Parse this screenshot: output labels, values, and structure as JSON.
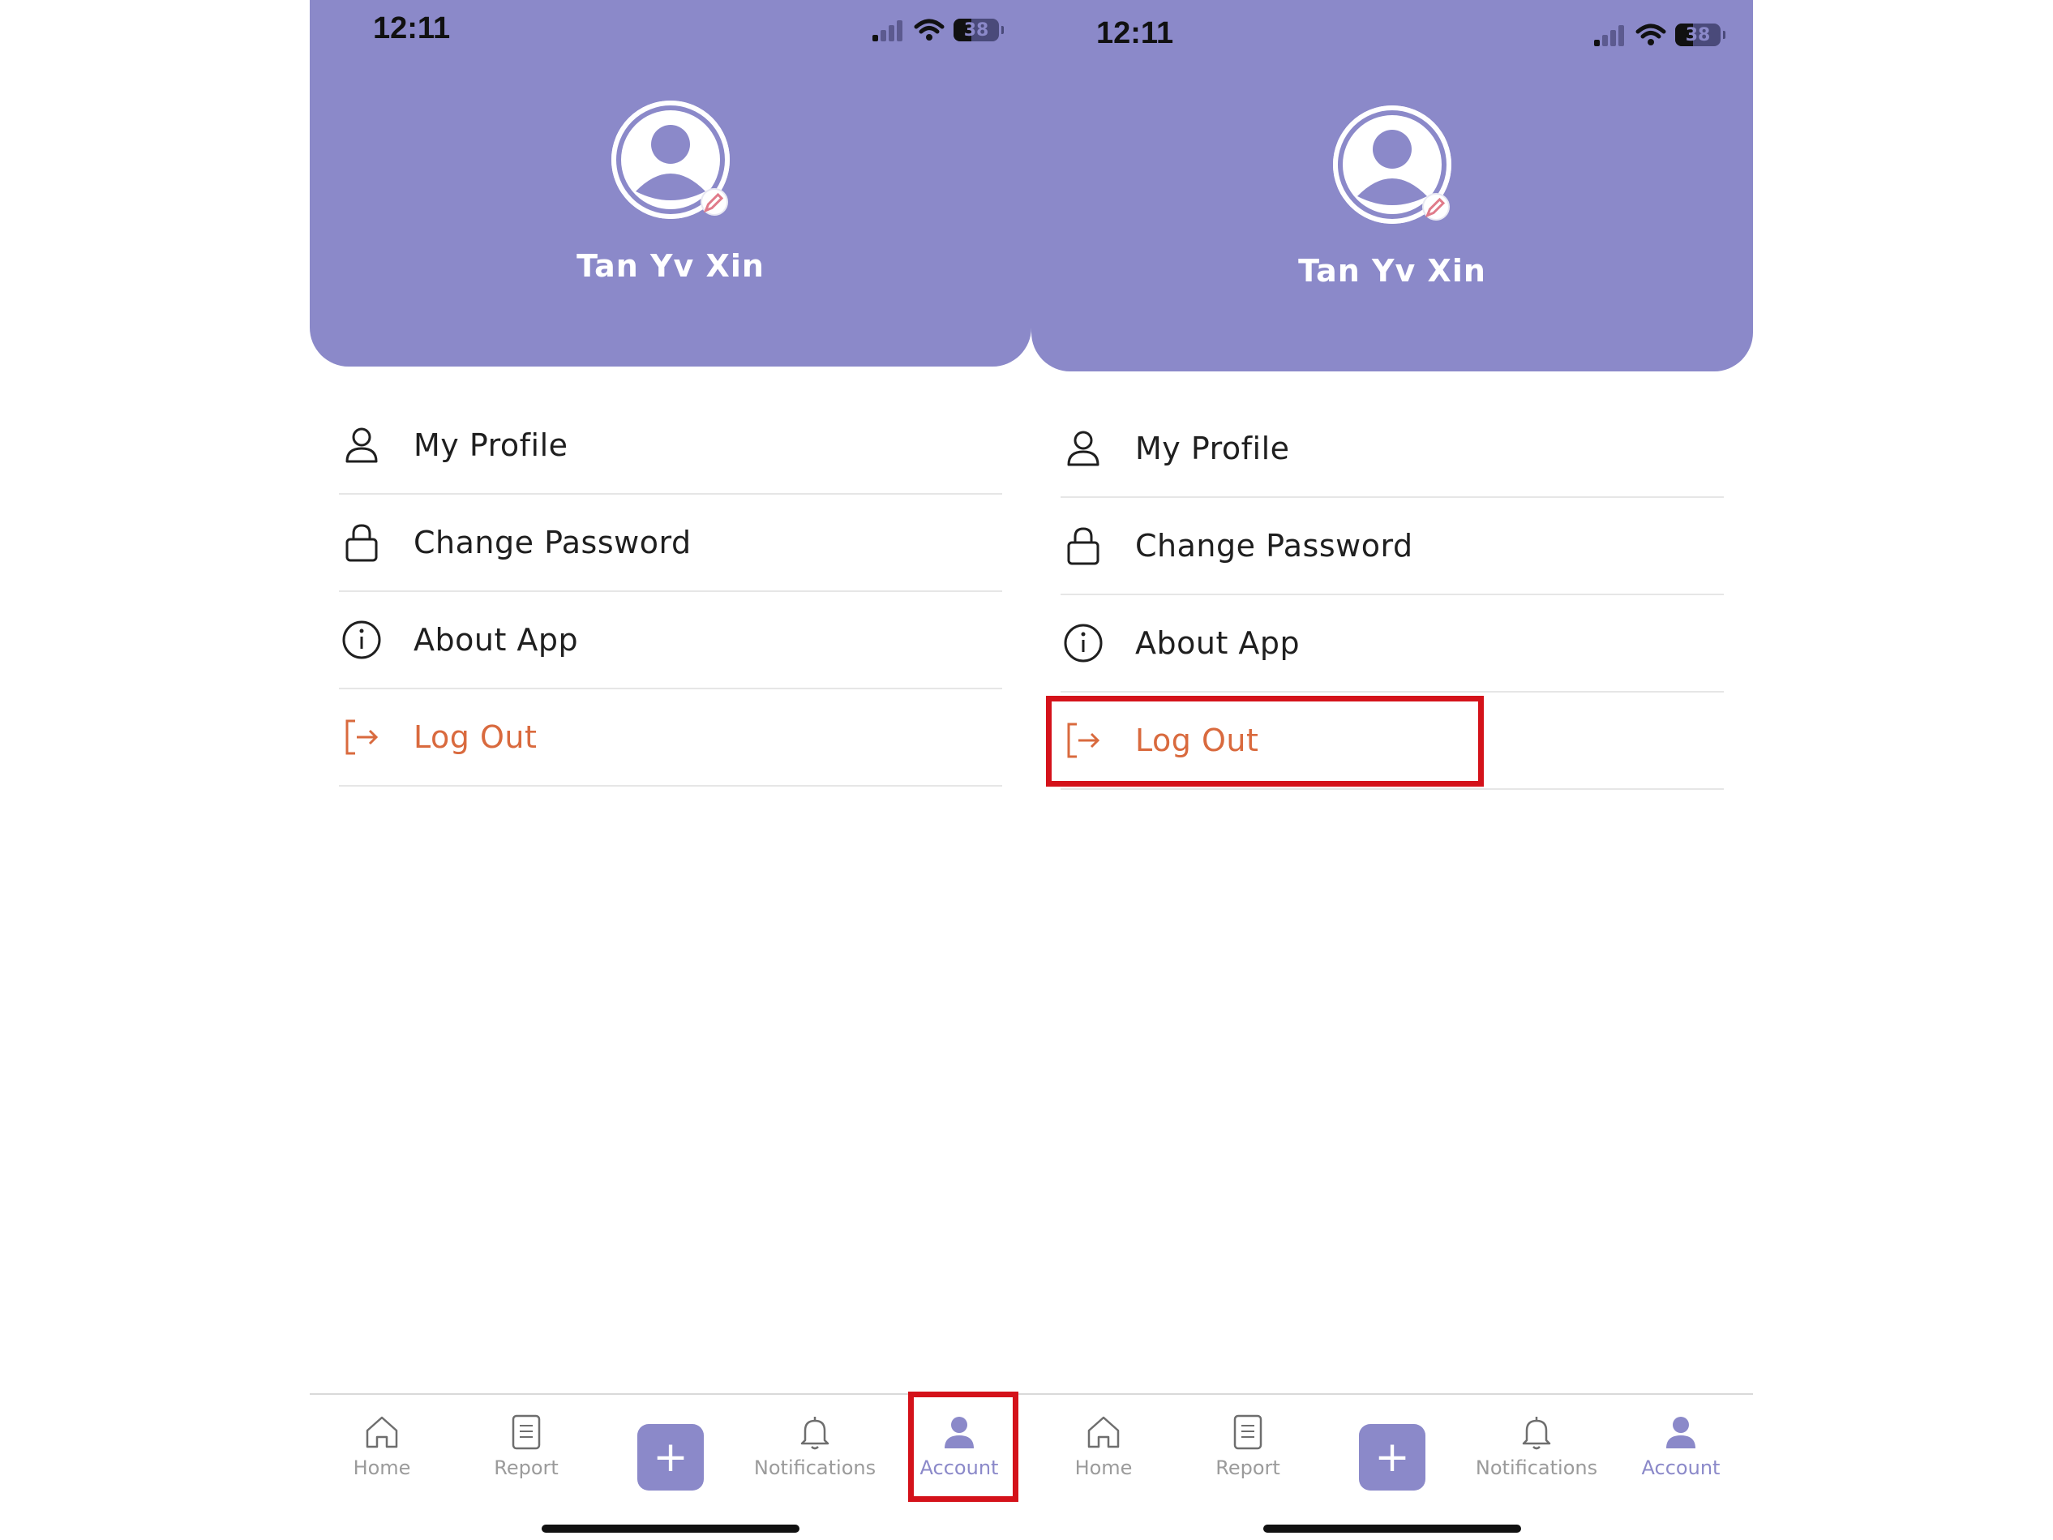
{
  "theme": {
    "header_color": "#8b89c9",
    "accent_color": "#8b89c9",
    "logout_color": "#d96a3e",
    "highlight_color": "#d4121a"
  },
  "status_bar": {
    "time": "12:11",
    "battery": "38",
    "icons": [
      "signal-icon",
      "wifi-icon",
      "battery-icon"
    ]
  },
  "profile": {
    "name": "Tan Yv Xin",
    "avatar_icon": "user-avatar-icon",
    "edit_icon": "pencil-icon"
  },
  "menu": {
    "items": [
      {
        "label": "My Profile",
        "icon": "user-icon"
      },
      {
        "label": "Change Password",
        "icon": "lock-icon"
      },
      {
        "label": "About App",
        "icon": "info-icon"
      },
      {
        "label": "Log Out",
        "icon": "logout-icon"
      }
    ]
  },
  "tabbar": {
    "tabs": [
      {
        "label": "Home",
        "icon": "home-icon"
      },
      {
        "label": "Report",
        "icon": "report-icon"
      },
      {
        "label": "",
        "icon": "plus-icon"
      },
      {
        "label": "Notifications",
        "icon": "bell-icon"
      },
      {
        "label": "Account",
        "icon": "account-icon"
      }
    ],
    "active": "Account"
  },
  "annotations": {
    "left_screen": "Account tab highlighted",
    "right_screen": "Log Out item highlighted"
  }
}
